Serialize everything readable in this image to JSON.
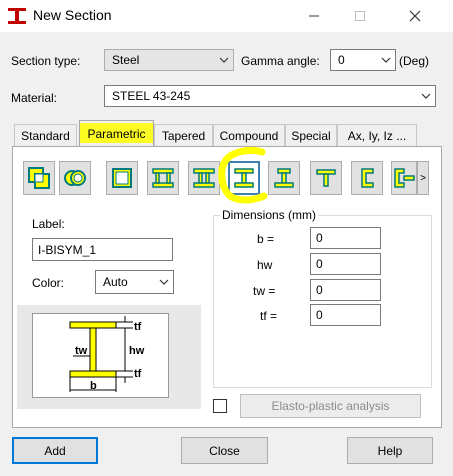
{
  "window": {
    "title": "New Section",
    "minimize_icon": "minimize-icon",
    "maximize_icon": "maximize-icon",
    "close_icon": "close-icon"
  },
  "form": {
    "section_type_label": "Section type:",
    "section_type_value": "Steel",
    "gamma_angle_label": "Gamma angle:",
    "gamma_angle_value": "0",
    "gamma_unit": "(Deg)",
    "material_label": "Material:",
    "material_value": "STEEL 43-245"
  },
  "tabs": [
    {
      "label": "Standard",
      "active": false
    },
    {
      "label": "Parametric",
      "active": true
    },
    {
      "label": "Tapered",
      "active": false
    },
    {
      "label": "Compound",
      "active": false
    },
    {
      "label": "Special",
      "active": false
    },
    {
      "label": "Ax, Iy, Iz ...",
      "active": false
    }
  ],
  "section_shapes": [
    {
      "name": "box-compound-icon"
    },
    {
      "name": "tube-circle-icon"
    },
    {
      "name": "rect-box-icon"
    },
    {
      "name": "double-box-icon"
    },
    {
      "name": "box-flanged-icon"
    },
    {
      "name": "i-bisym-icon",
      "selected": true
    },
    {
      "name": "i-monosym-icon"
    },
    {
      "name": "tee-icon"
    },
    {
      "name": "channel-icon"
    },
    {
      "name": "double-channel-icon"
    }
  ],
  "scroll_right": ">",
  "label_field": {
    "label": "Label:",
    "value": "I-BISYM_1"
  },
  "color_field": {
    "label": "Color:",
    "value": "Auto"
  },
  "diagram": {
    "tf_top": "tf",
    "hw": "hw",
    "tw": "tw",
    "tf_bottom": "tf",
    "b": "b"
  },
  "dimensions": {
    "title": "Dimensions (mm)",
    "rows": [
      {
        "label": "b  =",
        "value": "0"
      },
      {
        "label": "hw",
        "value": "0"
      },
      {
        "label": "tw  =",
        "value": "0"
      },
      {
        "label": "tf  =",
        "value": "0"
      }
    ]
  },
  "elasto_plastic": {
    "label": "Elasto-plastic analysis",
    "checked": false
  },
  "buttons": {
    "add": "Add",
    "close": "Close",
    "help": "Help"
  },
  "colors": {
    "accent": "#0078d7",
    "section_fill": "#ffff00",
    "annotation": "#ffff00"
  }
}
